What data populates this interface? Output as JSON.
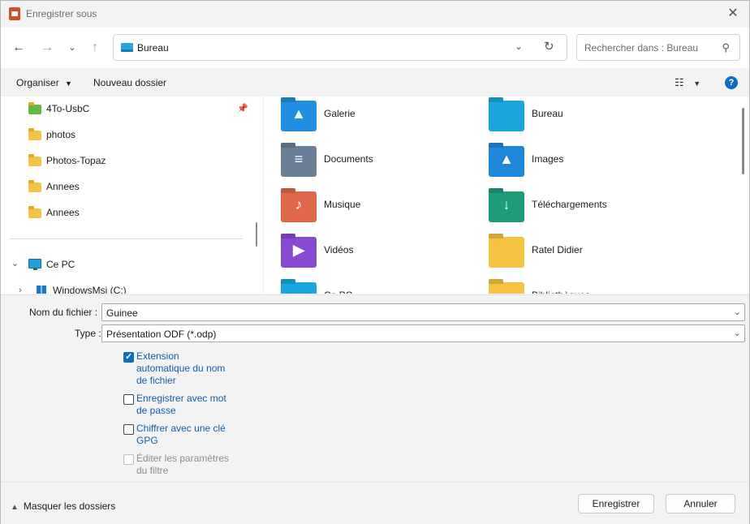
{
  "window": {
    "title": "Enregistrer sous"
  },
  "nav": {
    "address": "Bureau",
    "search_placeholder": "Rechercher dans : Bureau"
  },
  "toolbar": {
    "organize": "Organiser",
    "new_folder": "Nouveau dossier"
  },
  "sidebar": {
    "items": [
      {
        "label": "4To-UsbC",
        "icon": "folder-icon",
        "pinned": true
      },
      {
        "label": "photos",
        "icon": "folder-icon"
      },
      {
        "label": "Photos-Topaz",
        "icon": "folder-icon"
      },
      {
        "label": "Annees",
        "icon": "folder-icon"
      },
      {
        "label": "Annees",
        "icon": "folder-icon"
      }
    ],
    "this_pc": "Ce PC",
    "drive": "WindowsMsi (C:)"
  },
  "files": [
    {
      "label": "Galerie",
      "color": "#1f8fe0",
      "glyph": "▲"
    },
    {
      "label": "Bureau",
      "color": "#1ba6dd",
      "glyph": ""
    },
    {
      "label": "Documents",
      "color": "#6b7f96",
      "glyph": "≡"
    },
    {
      "label": "Images",
      "color": "#1e88d8",
      "glyph": "▲"
    },
    {
      "label": "Musique",
      "color": "#e0674a",
      "glyph": "♪"
    },
    {
      "label": "Téléchargements",
      "color": "#1c9c78",
      "glyph": "↓"
    },
    {
      "label": "Vidéos",
      "color": "#8a4ad0",
      "glyph": "▶"
    },
    {
      "label": "Ratel Didier",
      "color": "#f5c242",
      "glyph": ""
    },
    {
      "label": "Ce PC",
      "color": "#1ba6dd",
      "glyph": ""
    },
    {
      "label": "Bibliothèques",
      "color": "#f5c242",
      "glyph": ""
    }
  ],
  "form": {
    "filename_label": "Nom du fichier :",
    "filename_value": "Guinee",
    "type_label": "Type :",
    "type_value": "Présentation ODF (*.odp)",
    "options": [
      {
        "label": "Extension automatique du nom de fichier",
        "checked": true,
        "disabled": false
      },
      {
        "label": "Enregistrer avec mot de passe",
        "checked": false,
        "disabled": false
      },
      {
        "label": "Chiffrer avec une clé GPG",
        "checked": false,
        "disabled": false
      },
      {
        "label": "Éditer les paramètres du filtre",
        "checked": false,
        "disabled": true
      }
    ]
  },
  "footer": {
    "hide_folders": "Masquer les dossiers",
    "save": "Enregistrer",
    "cancel": "Annuler"
  }
}
